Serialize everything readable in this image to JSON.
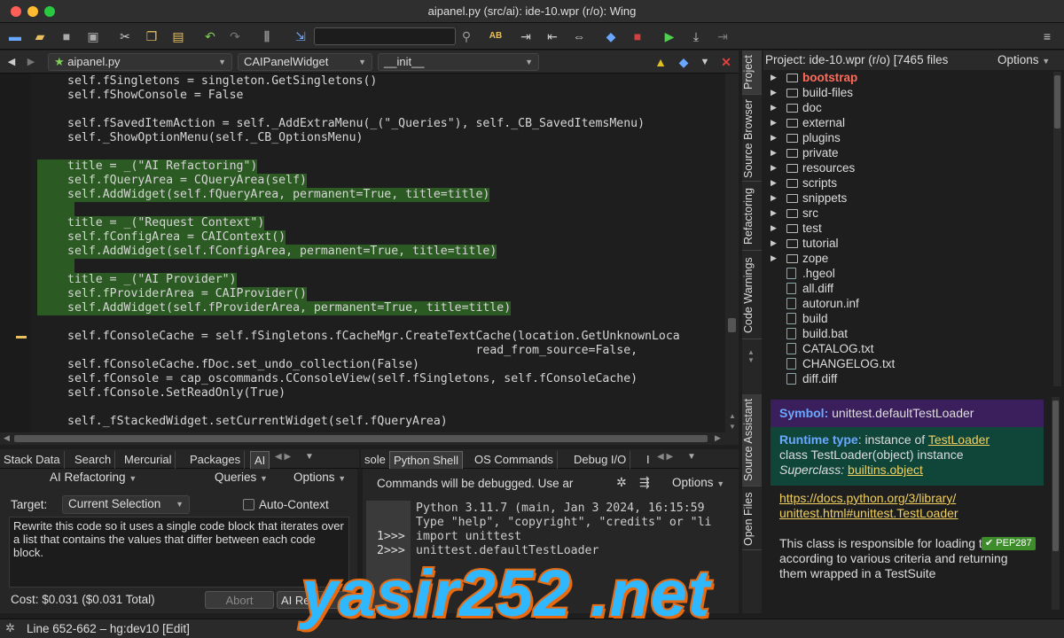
{
  "window": {
    "title": "aipanel.py (src/ai): ide-10.wpr (r/o): Wing"
  },
  "toolbar": {
    "icons": [
      "new-file-icon",
      "open-file-icon",
      "save-icon",
      "save-all-icon",
      "cut-icon",
      "copy-icon",
      "paste-icon",
      "undo-icon",
      "redo-icon",
      "indent-icon",
      "goto-icon",
      "search-icon",
      "spell-icon",
      "indent-right-icon",
      "indent-left-icon",
      "indent-toggle-icon",
      "python-icon",
      "stop-icon",
      "run-icon",
      "step-icon",
      "step-out-icon",
      "menu-icon"
    ],
    "search_value": ""
  },
  "editor": {
    "file_combo": "aipanel.py",
    "class_combo": "CAIPanelWidget",
    "method_combo": "__init__",
    "lines": [
      {
        "t": "self.fSingletons = singleton.GetSingletons()",
        "hl": false
      },
      {
        "t": "self.fShowConsole = False",
        "hl": false
      },
      {
        "t": "",
        "hl": false
      },
      {
        "t": "self.fSavedItemAction = self._AddExtraMenu(_(\"_Queries\"), self._CB_SavedItemsMenu)",
        "hl": false
      },
      {
        "t": "self._ShowOptionMenu(self._CB_OptionsMenu)",
        "hl": false
      },
      {
        "t": "",
        "hl": false
      },
      {
        "t": "title = _(\"AI Refactoring\")",
        "hl": true
      },
      {
        "t": "self.fQueryArea = CQueryArea(self)",
        "hl": true
      },
      {
        "t": "self.AddWidget(self.fQueryArea, permanent=True, title=title)",
        "hl": true
      },
      {
        "t": "",
        "hl": true
      },
      {
        "t": "title = _(\"Request Context\")",
        "hl": true
      },
      {
        "t": "self.fConfigArea = CAIContext()",
        "hl": true
      },
      {
        "t": "self.AddWidget(self.fConfigArea, permanent=True, title=title)",
        "hl": true
      },
      {
        "t": "",
        "hl": true
      },
      {
        "t": "title = _(\"AI Provider\")",
        "hl": true
      },
      {
        "t": "self.fProviderArea = CAIProvider()",
        "hl": true
      },
      {
        "t": "self.AddWidget(self.fProviderArea, permanent=True, title=title)",
        "hl": true
      },
      {
        "t": "",
        "hl": false
      },
      {
        "t": "self.fConsoleCache = self.fSingletons.fCacheMgr.CreateTextCache(location.GetUnknownLoca",
        "hl": false
      },
      {
        "t": "                                                          read_from_source=False,",
        "hl": false
      },
      {
        "t": "self.fConsoleCache.fDoc.set_undo_collection(False)",
        "hl": false
      },
      {
        "t": "self.fConsole = cap_oscommands.CConsoleView(self.fSingletons, self.fConsoleCache)",
        "hl": false
      },
      {
        "t": "self.fConsole.SetReadOnly(True)",
        "hl": false
      },
      {
        "t": "",
        "hl": false
      },
      {
        "t": "self._fStackedWidget.setCurrentWidget(self.fQueryArea)",
        "hl": false
      }
    ]
  },
  "left_tabs": [
    "Stack Data",
    "Search",
    "Mercurial",
    "Packages",
    "AI"
  ],
  "right_tabs": [
    "sole",
    "Python Shell",
    "OS Commands",
    "Debug I/O",
    "I"
  ],
  "ai_panel": {
    "refactoring_label": "AI Refactoring",
    "queries_label": "Queries",
    "options_label": "Options",
    "target_label": "Target:",
    "target_value": "Current Selection",
    "auto_context_label": "Auto-Context",
    "prompt": "Rewrite this code so it uses a single code block that iterates over a list that contains the values that differ between each code block.",
    "cost": "Cost: $0.031 ($0.031 Total)",
    "abort_label": "Abort",
    "ai_refactor_label": "AI Re"
  },
  "shell": {
    "notice": "Commands will be debugged.  Use ar",
    "options_label": "Options",
    "lines": [
      {
        "p": "",
        "t": "Python 3.11.7 (main, Jan  3 2024, 16:15:59"
      },
      {
        "p": "",
        "t": "Type \"help\", \"copyright\", \"credits\" or \"li"
      },
      {
        "p": "1>>>",
        "t": "import unittest"
      },
      {
        "p": "2>>>",
        "t": "unittest.defaultTestLoader"
      }
    ]
  },
  "status": {
    "text": "Line 652-662 – hg:dev10 [Edit]"
  },
  "side_tabs_top": [
    "Project",
    "Source Browser",
    "Refactoring",
    "Code Warnings"
  ],
  "side_tabs_bottom": [
    "Source Assistant",
    "Open Files"
  ],
  "project": {
    "header": "Project: ide-10.wpr (r/o) [7465 files",
    "options_label": "Options",
    "items": [
      {
        "name": "bootstrap",
        "type": "dir",
        "color": "#ff6b5a"
      },
      {
        "name": "build-files",
        "type": "dir",
        "color": "#dddddd"
      },
      {
        "name": "doc",
        "type": "dir",
        "color": "#dddddd"
      },
      {
        "name": "external",
        "type": "dir",
        "color": "#dddddd"
      },
      {
        "name": "plugins",
        "type": "dir",
        "color": "#dddddd"
      },
      {
        "name": "private",
        "type": "dir",
        "color": "#dddddd"
      },
      {
        "name": "resources",
        "type": "dir",
        "color": "#dddddd"
      },
      {
        "name": "scripts",
        "type": "dir",
        "color": "#dddddd"
      },
      {
        "name": "snippets",
        "type": "dir",
        "color": "#dddddd"
      },
      {
        "name": "src",
        "type": "dir",
        "color": "#dddddd"
      },
      {
        "name": "test",
        "type": "dir",
        "color": "#dddddd"
      },
      {
        "name": "tutorial",
        "type": "dir",
        "color": "#dddddd"
      },
      {
        "name": "zope",
        "type": "dir",
        "color": "#dddddd"
      },
      {
        "name": ".hgeol",
        "type": "file",
        "color": "#dddddd"
      },
      {
        "name": "all.diff",
        "type": "file",
        "color": "#dddddd"
      },
      {
        "name": "autorun.inf",
        "type": "file",
        "color": "#dddddd"
      },
      {
        "name": "build",
        "type": "file",
        "color": "#dddddd"
      },
      {
        "name": "build.bat",
        "type": "file",
        "color": "#dddddd"
      },
      {
        "name": "CATALOG.txt",
        "type": "file",
        "color": "#dddddd"
      },
      {
        "name": "CHANGELOG.txt",
        "type": "file",
        "color": "#dddddd"
      },
      {
        "name": "diff.diff",
        "type": "file",
        "color": "#dddddd"
      }
    ]
  },
  "source_assistant": {
    "symbol_label": "Symbol:",
    "symbol_value": "unittest.defaultTestLoader",
    "runtime_label": "Runtime type",
    "runtime_prefix": ": instance of ",
    "runtime_link": "TestLoader",
    "class_line": "class TestLoader(object) instance",
    "superclass_label": "Superclass:",
    "superclass_link": "builtins.object",
    "doc_url_1": "https://docs.python.org/3/library/",
    "doc_url_2": "unittest.html#unittest.TestLoader",
    "description": "This class is responsible for loading tests according to various criteria and returning them wrapped in a TestSuite",
    "badge": "✔ PEP287"
  },
  "watermark": "yasir252 .net",
  "colors": {
    "highlight": "#2c5a23",
    "keyword": "#e36ad9",
    "string": "#e6e0a0",
    "symbol_bg": "#3a1f5c",
    "runtime_bg": "#10463a",
    "link": "#f0d060",
    "bootstrap": "#ff6b5a",
    "badge": "#3d8d2a"
  }
}
